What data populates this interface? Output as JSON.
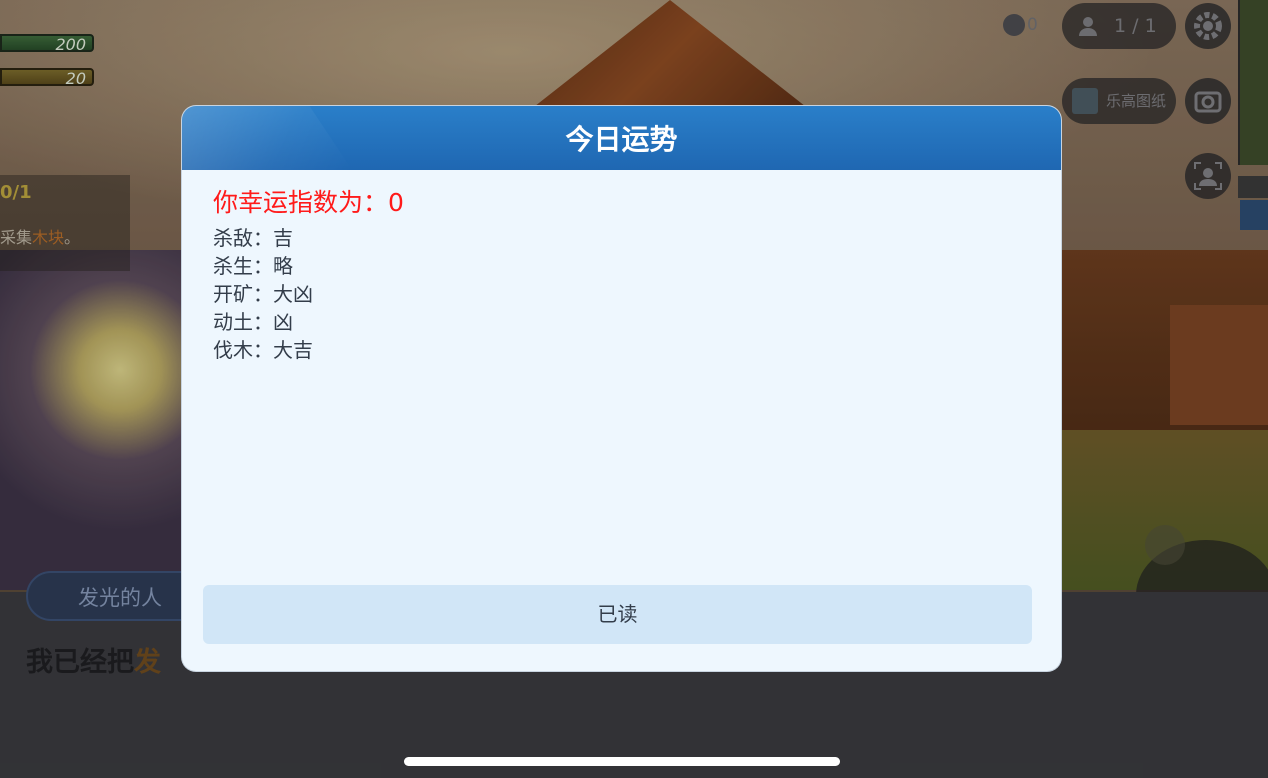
{
  "hud": {
    "hp_value": "200",
    "food_value": "20",
    "task_count": "0/1",
    "task_text_prefix": "采集",
    "task_text_item": "木块",
    "task_text_suffix": "。",
    "coin_count": "0",
    "players": "1 / 1",
    "lego_label": "乐高图纸"
  },
  "dialog": {
    "speaker": "发光的人",
    "text_prefix": "我已经把",
    "text_highlight": "发"
  },
  "modal": {
    "title": "今日运势",
    "luck_line": "你幸运指数为：0",
    "fortunes": [
      "杀敌：吉",
      "杀生：略",
      "开矿：大凶",
      "动土：凶",
      "伐木：大吉"
    ],
    "read_button": "已读"
  },
  "colors": {
    "header_blue": "#2a7fc9",
    "luck_red": "#ff1a1a",
    "button_bg": "#d1e6f7"
  },
  "icons": [
    "coin-icon",
    "player-icon",
    "settings-gear-icon",
    "blueprint-icon",
    "camera-icon",
    "view-switch-icon"
  ]
}
